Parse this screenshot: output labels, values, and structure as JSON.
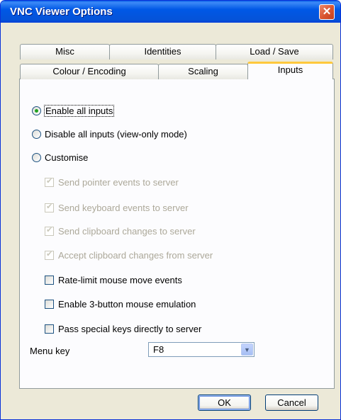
{
  "window": {
    "title": "VNC Viewer Options",
    "close_glyph": "✕"
  },
  "tabs": {
    "row1": [
      "Misc",
      "Identities",
      "Load / Save"
    ],
    "row2": [
      "Colour / Encoding",
      "Scaling",
      "Inputs"
    ],
    "active": "Inputs"
  },
  "inputs": {
    "radios": [
      {
        "label": "Enable all inputs",
        "checked": true
      },
      {
        "label": "Disable all inputs (view-only mode)",
        "checked": false
      },
      {
        "label": "Customise",
        "checked": false
      }
    ],
    "checkboxes": [
      {
        "label": "Send pointer events to server",
        "checked": true,
        "disabled": true
      },
      {
        "label": "Send keyboard events to server",
        "checked": true,
        "disabled": true
      },
      {
        "label": "Send clipboard changes to server",
        "checked": true,
        "disabled": true
      },
      {
        "label": "Accept clipboard changes from server",
        "checked": true,
        "disabled": true
      },
      {
        "label": "Rate-limit mouse move events",
        "checked": false,
        "disabled": false
      },
      {
        "label": "Enable 3-button mouse emulation",
        "checked": false,
        "disabled": false
      },
      {
        "label": "Pass special keys directly to server",
        "checked": false,
        "disabled": false
      }
    ],
    "menu_key": {
      "label": "Menu key",
      "value": "F8"
    }
  },
  "buttons": {
    "ok": "OK",
    "cancel": "Cancel"
  }
}
